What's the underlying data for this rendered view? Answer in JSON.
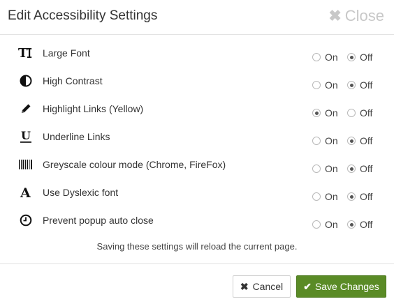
{
  "dialog": {
    "title": "Edit Accessibility Settings",
    "close_label": "Close",
    "close_icon": "close-icon"
  },
  "settings": [
    {
      "icon": "text-size-icon",
      "icon_glyph": "TI",
      "label": "Large Font",
      "on_label": "On",
      "off_label": "Off",
      "selected": "off"
    },
    {
      "icon": "contrast-icon",
      "icon_glyph": "",
      "label": "High Contrast",
      "on_label": "On",
      "off_label": "Off",
      "selected": "off"
    },
    {
      "icon": "pencil-icon",
      "icon_glyph": "",
      "label": "Highlight Links (Yellow)",
      "on_label": "On",
      "off_label": "Off",
      "selected": "on"
    },
    {
      "icon": "underline-icon",
      "icon_glyph": "U",
      "label": "Underline Links",
      "on_label": "On",
      "off_label": "Off",
      "selected": "off"
    },
    {
      "icon": "barcode-icon",
      "icon_glyph": "",
      "label": "Greyscale colour mode (Chrome, FireFox)",
      "on_label": "On",
      "off_label": "Off",
      "selected": "off"
    },
    {
      "icon": "font-icon",
      "icon_glyph": "A",
      "label": "Use Dyslexic font",
      "on_label": "On",
      "off_label": "Off",
      "selected": "off"
    },
    {
      "icon": "clock-icon",
      "icon_glyph": "",
      "label": "Prevent popup auto close",
      "on_label": "On",
      "off_label": "Off",
      "selected": "off"
    }
  ],
  "note": "Saving these settings will reload the current page.",
  "footer": {
    "cancel_label": "Cancel",
    "save_label": "Save Changes"
  },
  "colors": {
    "save_button": "#5a8b26",
    "close_text": "#c8c8c8"
  }
}
